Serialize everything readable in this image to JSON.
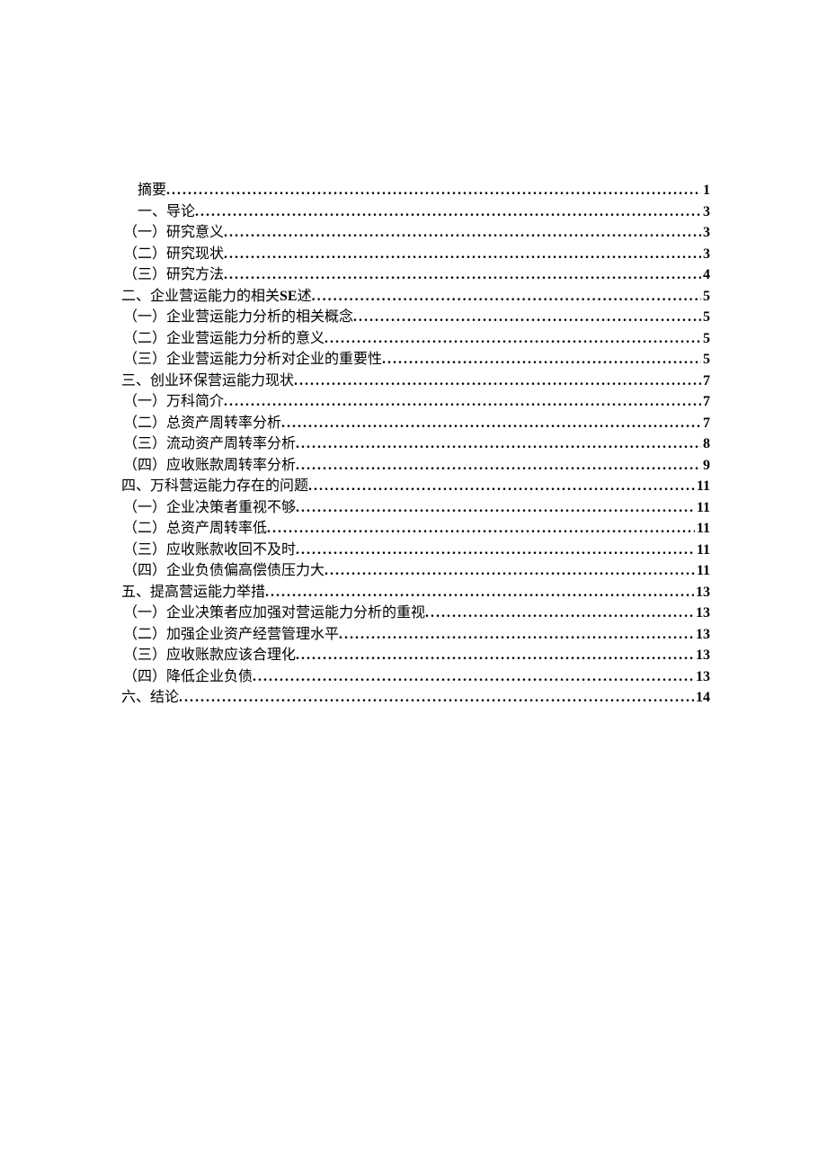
{
  "toc": [
    {
      "title": "摘要",
      "page": "1",
      "indent": "first",
      "se": false
    },
    {
      "title": "一、导论",
      "page": "3",
      "indent": "first",
      "se": false
    },
    {
      "title": "（一）研究意义",
      "page": "3",
      "indent": "indent",
      "se": false
    },
    {
      "title": "（二）研究现状",
      "page": "3",
      "indent": "indent",
      "se": false
    },
    {
      "title": "（三）研究方法",
      "page": "4",
      "indent": "indent",
      "se": false
    },
    {
      "title": "二、企业营运能力的相关",
      "title2": "述",
      "page": "5",
      "indent": "",
      "se": true
    },
    {
      "title": "（一）企业营运能力分析的相关概念",
      "page": "5",
      "indent": "indent",
      "se": false
    },
    {
      "title": "（二）企业营运能力分析的意义",
      "page": "5",
      "indent": "indent",
      "se": false
    },
    {
      "title": "（三）企业营运能力分析对企业的重要性",
      "page": "5",
      "indent": "indent",
      "se": false
    },
    {
      "title": "三、创业环保营运能力现状",
      "page": "7",
      "indent": "",
      "se": false
    },
    {
      "title": "（一）万科简介",
      "page": "7",
      "indent": "indent",
      "se": false
    },
    {
      "title": "（二）总资产周转率分析",
      "page": "7",
      "indent": "indent",
      "se": false
    },
    {
      "title": "（三）流动资产周转率分析",
      "page": "8",
      "indent": "indent",
      "se": false
    },
    {
      "title": "（四）应收账款周转率分析",
      "page": "9",
      "indent": "indent",
      "se": false
    },
    {
      "title": "四、万科营运能力存在的问题",
      "page": "11",
      "indent": "",
      "se": false
    },
    {
      "title": "（一）企业决策者重视不够",
      "page": "11",
      "indent": "indent",
      "se": false
    },
    {
      "title": "（二）总资产周转率低",
      "page": "11",
      "indent": "indent",
      "se": false
    },
    {
      "title": "（三）应收账款收回不及时",
      "page": "11",
      "indent": "indent",
      "se": false
    },
    {
      "title": "（四）企业负债偏高偿债压力大",
      "page": "11",
      "indent": "indent",
      "se": false
    },
    {
      "title": "五、提高营运能力举措",
      "page": "13",
      "indent": "",
      "se": false
    },
    {
      "title": "（一）企业决策者应加强对营运能力分析的重视",
      "page": "13",
      "indent": "indent",
      "se": false
    },
    {
      "title": "（二）加强企业资产经营管理水平",
      "page": "13",
      "indent": "indent",
      "se": false
    },
    {
      "title": "（三）应收账款应该合理化",
      "page": "13",
      "indent": "indent",
      "se": false
    },
    {
      "title": "（四）降低企业负债",
      "page": "13",
      "indent": "indent",
      "se": false
    },
    {
      "title": "六、结论",
      "page": "14",
      "indent": "",
      "se": false
    }
  ],
  "se_label": "SE"
}
